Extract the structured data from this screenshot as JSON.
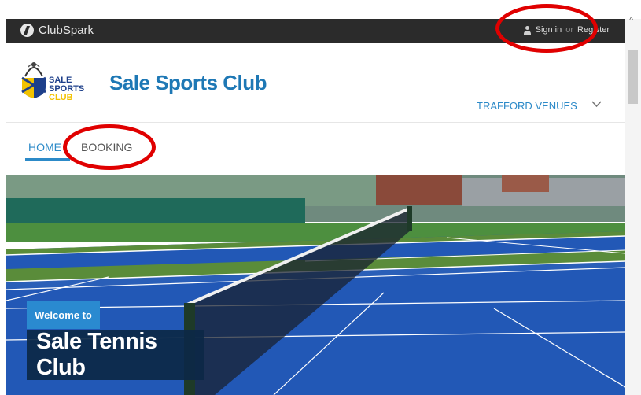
{
  "topbar": {
    "brand": "ClubSpark",
    "sign_in": "Sign in",
    "or": "or",
    "register": "Register"
  },
  "header": {
    "crest_line1": "SALE",
    "crest_line2": "SPORTS",
    "crest_line3": "CLUB",
    "club_name": "Sale Sports Club",
    "venues_label": "TRAFFORD VENUES",
    "venues_icon": "chevron-down-icon"
  },
  "nav": {
    "items": [
      {
        "label": "HOME"
      },
      {
        "label": "BOOKING"
      }
    ]
  },
  "hero": {
    "welcome": "Welcome to",
    "title": "Sale Tennis Club"
  },
  "colors": {
    "brand_blue": "#1e78b5",
    "nav_blue": "#2c8ac8",
    "court_blue": "#2258b6",
    "court_green": "#5a8c3a",
    "highlight_red": "#e00000"
  }
}
